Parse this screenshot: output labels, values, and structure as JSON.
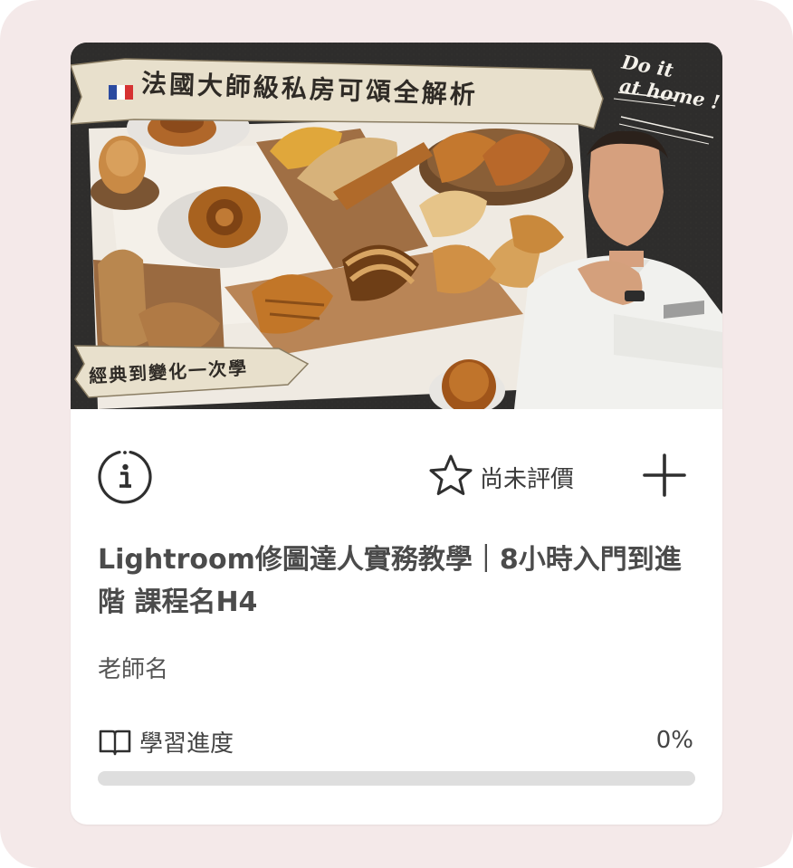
{
  "cover": {
    "banner_title": "法國大師級私房可頌全解析",
    "banner_subtitle": "經典到變化一次學",
    "tagline_line1": "Do it",
    "tagline_line2": "at home !"
  },
  "course": {
    "title": "Lightroom修圖達人實務教學｜8小時入門到進階 課程名H4",
    "teacher": "老師名"
  },
  "actions": {
    "info_icon": "info-icon",
    "rating_icon": "star-icon",
    "rating_label": "尚未評價",
    "add_icon": "plus-icon"
  },
  "progress": {
    "icon": "book-icon",
    "label": "學習進度",
    "value_text": "0%",
    "fraction": 0
  },
  "colors": {
    "page_background": "#f4e9e9",
    "card_background": "#ffffff",
    "progress_track": "#dedede",
    "text_primary": "#4b4b4b"
  }
}
